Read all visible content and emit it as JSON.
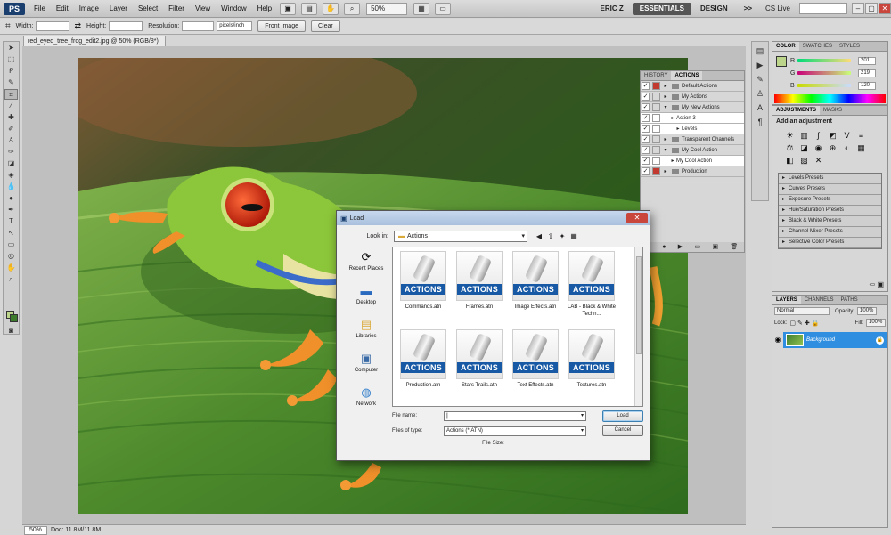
{
  "app": {
    "logo": "PS",
    "menus": [
      "File",
      "Edit",
      "Image",
      "Layer",
      "Select",
      "Filter",
      "View",
      "Window",
      "Help"
    ],
    "zoom": "50%",
    "user": "ERIC Z",
    "workspaces": [
      "ESSENTIALS",
      "DESIGN"
    ],
    "more": ">>",
    "cs_live": "CS Live",
    "window_controls": [
      "–",
      "▢",
      "✕"
    ]
  },
  "options": {
    "width_label": "Width:",
    "height_label": "Height:",
    "resolution_label": "Resolution:",
    "resolution_unit": "pixels/inch",
    "front_image": "Front Image",
    "clear": "Clear"
  },
  "document": {
    "tab_title": "red_eyed_tree_frog_edit2.jpg @ 50% (RGB/8*)",
    "zoom_status": "50%",
    "doc_size": "Doc: 11.8M/11.8M"
  },
  "color_panel": {
    "tabs": [
      "COLOR",
      "SWATCHES",
      "STYLES"
    ],
    "channels": [
      {
        "label": "R",
        "value": "201"
      },
      {
        "label": "G",
        "value": "219"
      },
      {
        "label": "B",
        "value": "120"
      }
    ]
  },
  "adjustments": {
    "tabs": [
      "ADJUSTMENTS",
      "MASKS"
    ],
    "title": "Add an adjustment",
    "presets": [
      "Levels Presets",
      "Curves Presets",
      "Exposure Presets",
      "Hue/Saturation Presets",
      "Black & White Presets",
      "Channel Mixer Presets",
      "Selective Color Presets"
    ]
  },
  "layers": {
    "tabs": [
      "LAYERS",
      "CHANNELS",
      "PATHS"
    ],
    "blend_mode": "Normal",
    "opacity_label": "Opacity:",
    "opacity": "100%",
    "lock_label": "Lock:",
    "fill_label": "Fill:",
    "fill": "100%",
    "layer_name": "Background"
  },
  "actions_panel": {
    "tabs": [
      "HISTORY",
      "ACTIONS"
    ],
    "rows": [
      {
        "label": "Default Actions",
        "kind": "folder",
        "red": true
      },
      {
        "label": "My Actions",
        "kind": "folder",
        "red": false
      },
      {
        "label": "My New Actions",
        "kind": "folder-open",
        "red": false
      },
      {
        "label": "Action 3",
        "kind": "action",
        "red": false
      },
      {
        "label": "Levels",
        "kind": "step",
        "red": false
      },
      {
        "label": "Transparent Channels",
        "kind": "folder",
        "red": false
      },
      {
        "label": "My Cool Action",
        "kind": "folder-open",
        "red": false
      },
      {
        "label": "My Cool Action",
        "kind": "action",
        "red": false
      },
      {
        "label": "Production",
        "kind": "folder",
        "red": true
      }
    ]
  },
  "dialog": {
    "title": "Load",
    "look_in_label": "Look in:",
    "look_in_value": "Actions",
    "places": [
      {
        "label": "Recent Places",
        "icon": "recent-places-icon"
      },
      {
        "label": "Desktop",
        "icon": "desktop-icon"
      },
      {
        "label": "Libraries",
        "icon": "libraries-icon"
      },
      {
        "label": "Computer",
        "icon": "computer-icon"
      },
      {
        "label": "Network",
        "icon": "network-icon"
      }
    ],
    "badge": "ACTIONS",
    "files": [
      "Commands.atn",
      "Frames.atn",
      "Image Effects.atn",
      "LAB - Black & White Techn...",
      "Production.atn",
      "Stars Trails.atn",
      "Text Effects.atn",
      "Textures.atn"
    ],
    "file_name_label": "File name:",
    "file_name_value": "|",
    "file_type_label": "Files of type:",
    "file_type_value": "Actions (*.ATN)",
    "load_button": "Load",
    "cancel_button": "Cancel",
    "file_size_label": "File Size:"
  }
}
